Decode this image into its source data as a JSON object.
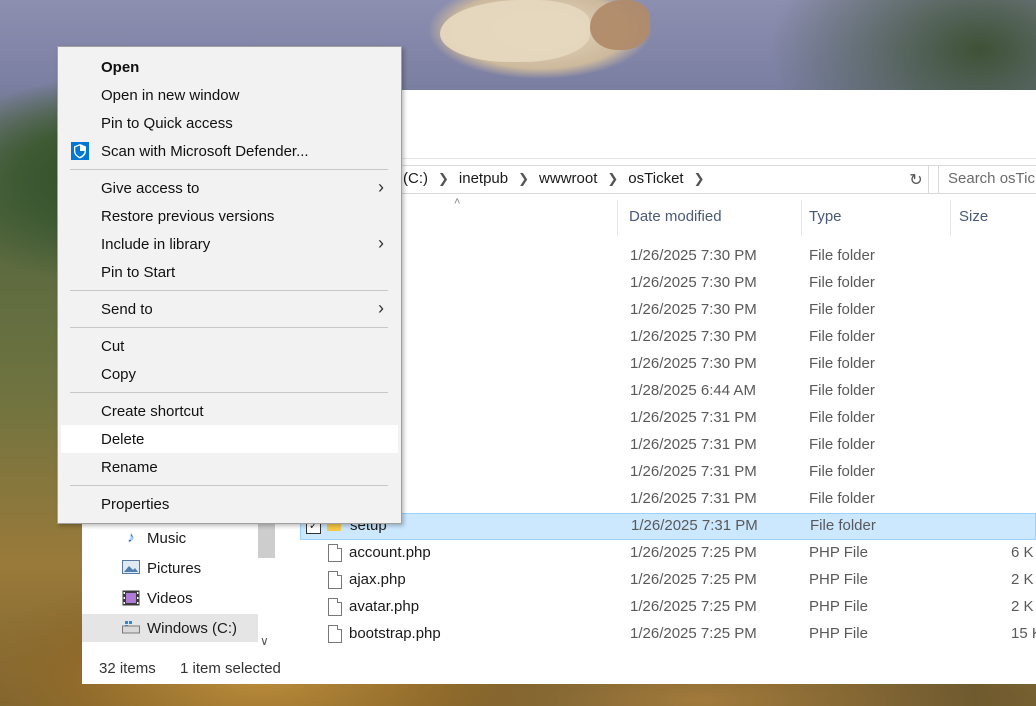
{
  "context_menu": {
    "items": [
      {
        "label": "Open",
        "bold": true
      },
      {
        "label": "Open in new window"
      },
      {
        "label": "Pin to Quick access"
      },
      {
        "label": "Scan with Microsoft Defender...",
        "icon": "defender-shield-icon"
      },
      {
        "label": "Give access to",
        "submenu": true
      },
      {
        "label": "Restore previous versions"
      },
      {
        "label": "Include in library",
        "submenu": true
      },
      {
        "label": "Pin to Start"
      },
      {
        "label": "Send to",
        "submenu": true
      },
      {
        "label": "Cut"
      },
      {
        "label": "Copy"
      },
      {
        "label": "Create shortcut"
      },
      {
        "label": "Delete",
        "highlighted": true
      },
      {
        "label": "Rename"
      },
      {
        "label": "Properties"
      }
    ]
  },
  "address_bar": {
    "crumbs": [
      "(C:)",
      "inetpub",
      "wwwroot",
      "osTicket"
    ]
  },
  "search": {
    "placeholder": "Search osTicket"
  },
  "columns": {
    "date": "Date modified",
    "type": "Type",
    "size": "Size"
  },
  "files": [
    {
      "name": "",
      "date": "1/26/2025 7:30 PM",
      "type": "File folder",
      "size": ""
    },
    {
      "name": "",
      "date": "1/26/2025 7:30 PM",
      "type": "File folder",
      "size": ""
    },
    {
      "name": "",
      "date": "1/26/2025 7:30 PM",
      "type": "File folder",
      "size": ""
    },
    {
      "name": "",
      "date": "1/26/2025 7:30 PM",
      "type": "File folder",
      "size": ""
    },
    {
      "name": "",
      "date": "1/26/2025 7:30 PM",
      "type": "File folder",
      "size": ""
    },
    {
      "name": "",
      "date": "1/28/2025 6:44 AM",
      "type": "File folder",
      "size": ""
    },
    {
      "name": "",
      "date": "1/26/2025 7:31 PM",
      "type": "File folder",
      "size": ""
    },
    {
      "name": "",
      "date": "1/26/2025 7:31 PM",
      "type": "File folder",
      "size": ""
    },
    {
      "name": "",
      "date": "1/26/2025 7:31 PM",
      "type": "File folder",
      "size": ""
    },
    {
      "name": "",
      "date": "1/26/2025 7:31 PM",
      "type": "File folder",
      "size": ""
    },
    {
      "name": "setup",
      "date": "1/26/2025 7:31 PM",
      "type": "File folder",
      "size": "",
      "selected": true
    },
    {
      "name": "account.php",
      "date": "1/26/2025 7:25 PM",
      "type": "PHP File",
      "size": "6 K"
    },
    {
      "name": "ajax.php",
      "date": "1/26/2025 7:25 PM",
      "type": "PHP File",
      "size": "2 K"
    },
    {
      "name": "avatar.php",
      "date": "1/26/2025 7:25 PM",
      "type": "PHP File",
      "size": "2 K"
    },
    {
      "name": "bootstrap.php",
      "date": "1/26/2025 7:25 PM",
      "type": "PHP File",
      "size": "15 K"
    }
  ],
  "nav": [
    {
      "label": "Music",
      "icon": "music-note-icon"
    },
    {
      "label": "Pictures",
      "icon": "pictures-icon"
    },
    {
      "label": "Videos",
      "icon": "videos-icon"
    },
    {
      "label": "Windows (C:)",
      "icon": "drive-icon",
      "active": true
    }
  ],
  "status": {
    "items": "32 items",
    "selected": "1 item selected"
  }
}
